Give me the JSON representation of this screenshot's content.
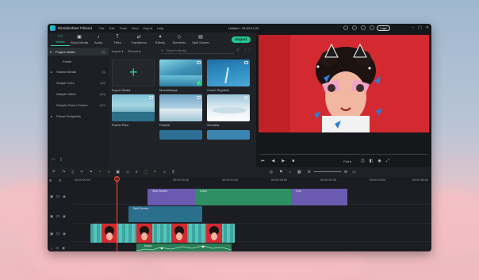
{
  "app": {
    "name": "Wondershare Filmora",
    "menu": [
      "File",
      "Edit",
      "Tools",
      "View",
      "Export",
      "Help"
    ],
    "project_title": "Untitled : 00:00:21:20",
    "login_label": "Login",
    "window_controls": [
      "–",
      "▢",
      "✕"
    ]
  },
  "tabs": [
    {
      "label": "Media",
      "icon": "▭"
    },
    {
      "label": "Stock Media",
      "icon": "▣"
    },
    {
      "label": "Audio",
      "icon": "♪"
    },
    {
      "label": "Titles",
      "icon": "T"
    },
    {
      "label": "Transitions",
      "icon": "⇄"
    },
    {
      "label": "Effects",
      "icon": "✦"
    },
    {
      "label": "Elements",
      "icon": "◇"
    },
    {
      "label": "Split Screen",
      "icon": "▤"
    }
  ],
  "export_label": "Export",
  "sidebar": {
    "items": [
      {
        "label": "Project Media",
        "count": "(5)"
      },
      {
        "label": "Folder",
        "count": ""
      },
      {
        "label": "Shared Media",
        "count": "(3)"
      },
      {
        "label": "Simple Color",
        "count": "(15)"
      },
      {
        "label": "Sample Video",
        "count": "(20)"
      },
      {
        "label": "Sample Green Screen",
        "count": "(10)"
      },
      {
        "label": "Preset Templates",
        "count": ""
      }
    ],
    "footer_icons": [
      "▭",
      "▯"
    ]
  },
  "media": {
    "import_dropdown": "Import",
    "record_dropdown": "Record",
    "search_placeholder": "Search Media",
    "items": [
      {
        "label": "Import Media"
      },
      {
        "label": "Mozambique"
      },
      {
        "label": "Czech Republic"
      },
      {
        "label": "Puerto Rico"
      },
      {
        "label": "Finland"
      },
      {
        "label": "Slovakia"
      }
    ]
  },
  "preview": {
    "quality": "Full",
    "controls": [
      "⏮",
      "◀",
      "▶",
      "■"
    ]
  },
  "timeline": {
    "ruler_labels": [
      "00:00:00:00",
      "00:00:05:00",
      "00:00:10:00",
      "00:00:15:00",
      "00:00:20:00",
      "00:00:25:00",
      "00:00:30:00"
    ],
    "clips": {
      "title_a": "Split Screen",
      "title_b": "Lined",
      "title_c": "Line",
      "split": "Split Screen",
      "audio": "Music"
    }
  },
  "colors": {
    "accent": "#21c78f",
    "playhead": "#ff4b3a",
    "title_clip_purple": "#6b5bb0",
    "title_clip_green": "#2f8f64",
    "split_clip": "#2a6f8c"
  }
}
